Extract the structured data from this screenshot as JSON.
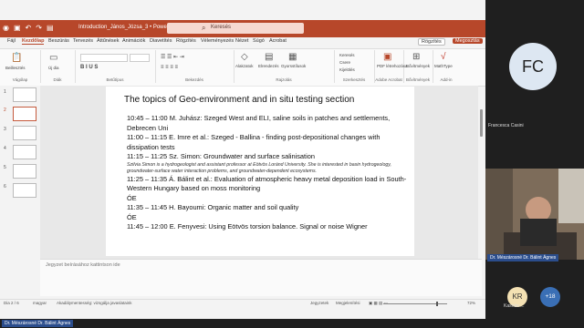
{
  "app": {
    "filename": "Introduction_János_Józsa_3 • PowerPoint",
    "search_placeholder": "Keresés",
    "comment_label": "Rögzítés",
    "share_label": "Megosztás"
  },
  "tabs": [
    "Fájl",
    "Kezdőlap",
    "Beszúrás",
    "Tervezés",
    "Áttűnések",
    "Animációk",
    "Diavetítés",
    "Rögzítés",
    "Véleményezés",
    "Nézet",
    "Súgó",
    "Acrobat"
  ],
  "ribbon": {
    "groups": [
      "Vágólap",
      "Diák",
      "Betűtípus",
      "Bekezdés",
      "Rajzolás",
      "Szerkesztés",
      "Adobe Acrobat",
      "Bővítmények",
      "Add-in"
    ],
    "buttons": {
      "paste": "Beillesztés",
      "new_slide": "Új dia",
      "shapes": "Alakzatok",
      "arrange": "Elrendezés",
      "quick_styles": "Gyorsstílusok",
      "find": "Keresés",
      "replace": "Csere",
      "select": "Kijelölés",
      "pdf": "PDF létrehozása",
      "addins": "Bővítmények",
      "mathtype": "MathType"
    }
  },
  "thumbs": [
    "1",
    "2",
    "3",
    "4",
    "5",
    "6"
  ],
  "slide": {
    "title": "The topics of Geo-environment and in situ testing section",
    "lines": [
      "10:45 – 11:00  M. Juhász: Szeged West and ELI, saline soils in patches and settlements, Debrecen Uni",
      "11:00 – 11:15  E. Imre et al.: Szeged - Ballina - finding post-depositional changes with dissipation tests",
      "11:15 – 11:25  Sz. Simon: Groundwater and surface salinisation",
      "Szilvia Simon is a hydrogeologist and assistant professor at Eötvös Loránd University. She is interested in basin hydrogeology, groundwater-surface water interaction problems, and groundwater-dependent ecosystems.",
      "11:25 – 11:35  Á. Bálint et al.: Evaluation of atmospheric heavy metal deposition load in South-Western Hungary based on moss monitoring",
      "ÓE",
      "11:35 – 11:45  H. Bayoumi: Organic matter and soil quality",
      "ÓE",
      "11:45 – 12:00  E. Fenyvesi: Using Eötvös torsion balance. Signal or noise Wigner"
    ]
  },
  "notes_placeholder": "Jegyzet beírásához kattintson ide",
  "status": {
    "slide": "Dia 2 / 6",
    "language": "magyar",
    "accessibility": "Akadálymentesség: vizsgálja javaslataink",
    "notes": "Jegyzetek",
    "display": "Megjelenítési",
    "zoom": "72%"
  },
  "participants": {
    "fc_initials": "FC",
    "fc_name": "Francesca Casini",
    "video_name": "Dr. Mészárosné Dr. Bálint Ágnes",
    "presenter_name": "Dr. Mészárosné Dr. Bálint Ágnes",
    "kr_initials": "KR",
    "kr_name": "Kasnán ...",
    "more": "+18"
  }
}
